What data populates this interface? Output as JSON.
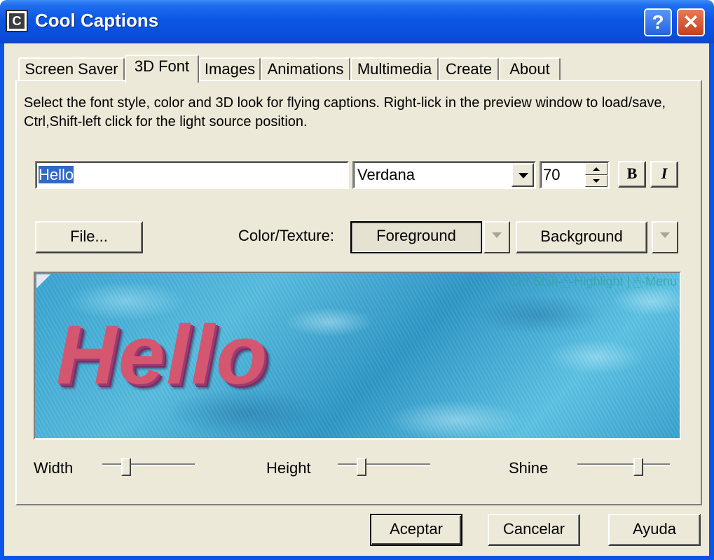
{
  "window": {
    "title": "Cool Captions",
    "icon_letter": "C",
    "help_glyph": "?",
    "close_glyph": "✕"
  },
  "tabs": [
    {
      "label": "Screen Saver",
      "active": false
    },
    {
      "label": "3D Font",
      "active": true
    },
    {
      "label": "Images",
      "active": false
    },
    {
      "label": "Animations",
      "active": false
    },
    {
      "label": "Multimedia",
      "active": false
    },
    {
      "label": "Create",
      "active": false
    },
    {
      "label": "About",
      "active": false
    }
  ],
  "panel": {
    "description": "Select the font style, color and 3D look for flying captions. Right-lick in the preview window to load/save, Ctrl,Shift-left click for the light source position.",
    "caption_text": "Hello",
    "font_name": "Verdana",
    "font_size": "70",
    "bold_label": "B",
    "italic_label": "I",
    "file_button": "File...",
    "color_texture_label": "Color/Texture:",
    "foreground_button": "Foreground",
    "background_button": "Background",
    "preview_hint": "Ctrl-Shift-🖱-Highlight | 🖱-Menu",
    "preview_text": "Hello",
    "sliders": [
      {
        "label": "Width",
        "value": 0.25
      },
      {
        "label": "Height",
        "value": 0.25
      },
      {
        "label": "Shine",
        "value": 0.65
      }
    ]
  },
  "footer": {
    "ok_button": "Aceptar",
    "cancel_button": "Cancelar",
    "help_button": "Ayuda"
  },
  "colors": {
    "titlebar": "#0a55e8",
    "dialog_bg": "#ece9d8",
    "selection": "#316ac5",
    "preview_bg": "#3aa6d2",
    "preview_text": "#d5566f"
  },
  "icons": {
    "combo_dropdown": "chevron-down-icon",
    "spin_up": "arrow-up-icon",
    "spin_down": "arrow-down-icon",
    "color_dropdown": "chevron-down-icon"
  }
}
